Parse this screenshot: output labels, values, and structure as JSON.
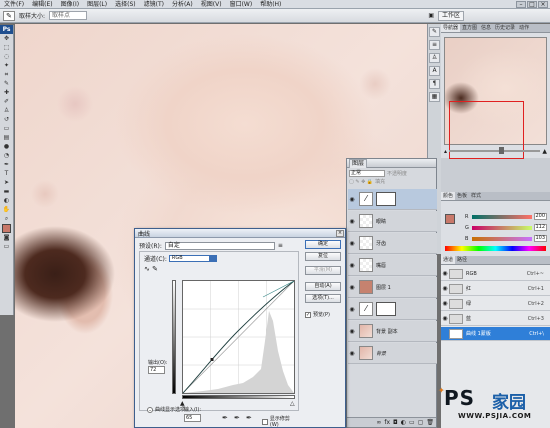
{
  "menubar": {
    "items": [
      "文件(F)",
      "编辑(E)",
      "图像(I)",
      "图层(L)",
      "选择(S)",
      "滤镜(T)",
      "分析(A)",
      "视图(V)",
      "窗口(W)",
      "帮助(H)"
    ]
  },
  "optionsbar": {
    "sample_size_label": "取样大小:",
    "sample_size_value": "取样点",
    "workspace_label": "工作区"
  },
  "toolbox": {
    "logo": "Ps"
  },
  "navigator": {
    "tabs": [
      "导航器",
      "直方图",
      "信息",
      "历史记录",
      "动作"
    ]
  },
  "color_panel": {
    "tabs": [
      "颜色",
      "色板",
      "样式"
    ],
    "r_label": "R",
    "g_label": "G",
    "b_label": "B",
    "r_value": "200",
    "g_value": "112",
    "b_value": "103",
    "foreground_color": "#c8786a"
  },
  "layers_panel": {
    "tab": "图层",
    "blend_mode": "正常",
    "opacity_label": "不透明度",
    "fill_label": "填充",
    "layers": [
      {
        "name": "",
        "type": "adj",
        "mask": true,
        "selected": true
      },
      {
        "name": "眼睛",
        "type": "transparent"
      },
      {
        "name": "牙齿",
        "type": "transparent"
      },
      {
        "name": "嘴唇",
        "type": "transparent"
      },
      {
        "name": "图层 1",
        "type": "solid"
      },
      {
        "name": "",
        "type": "adj",
        "mask": true
      },
      {
        "name": "背景 副本",
        "type": "photo"
      },
      {
        "name": "背景",
        "type": "photo"
      }
    ]
  },
  "channels_panel": {
    "tabs": [
      "通道",
      "路径"
    ],
    "rows": [
      {
        "name": "RGB",
        "shortcut": "Ctrl+~"
      },
      {
        "name": "红",
        "shortcut": "Ctrl+1"
      },
      {
        "name": "绿",
        "shortcut": "Ctrl+2"
      },
      {
        "name": "蓝",
        "shortcut": "Ctrl+3"
      },
      {
        "name": "曲线 1蒙版",
        "shortcut": "Ctrl+\\"
      }
    ]
  },
  "curves_dialog": {
    "title": "曲线",
    "preset_label": "预设(R):",
    "preset_value": "自定",
    "channel_label": "通道(C):",
    "channel_value": "RGB",
    "buttons": {
      "ok": "确定",
      "reset": "复位",
      "smooth": "平滑(M)",
      "auto": "自动(A)",
      "options": "选项(T)..."
    },
    "preview_label": "预览(P)",
    "output_label": "输出(O):",
    "output_value": "72",
    "input_label": "输入(I):",
    "input_value": "65",
    "show_clipping_label": "显示修剪(W)",
    "curve_display_label": "曲线显示选项",
    "control_point": {
      "input": 65,
      "output": 72
    }
  },
  "watermark": {
    "ps": "PS",
    "jia": "家园",
    "url": "WWW.PSJIA.COM"
  }
}
